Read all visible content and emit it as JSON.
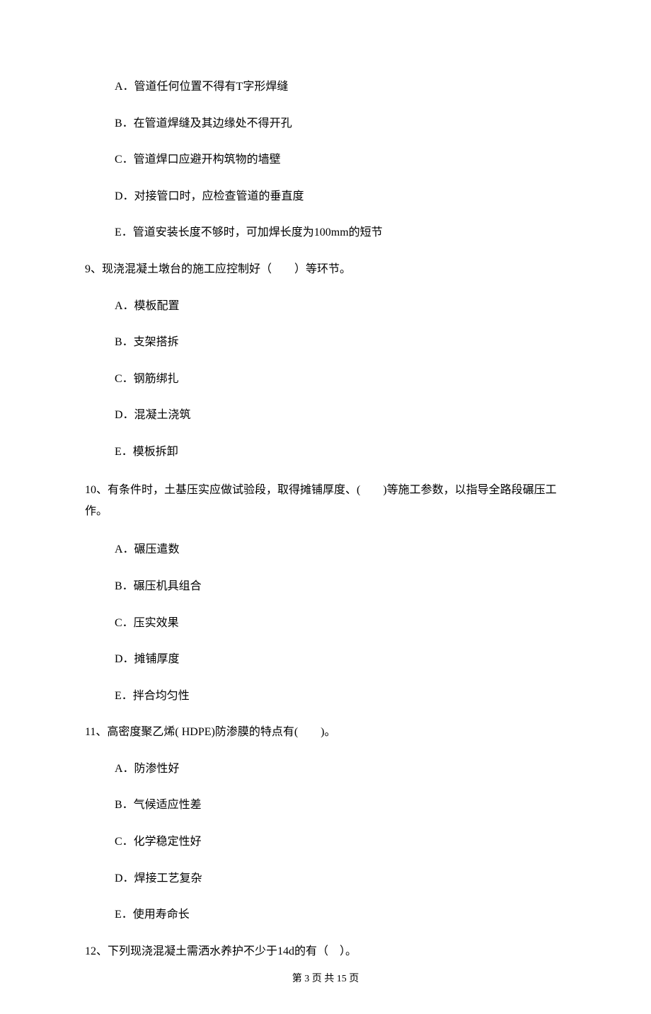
{
  "q8": {
    "options": {
      "A": "A．管道任何位置不得有T字形焊缝",
      "B": "B．在管道焊缝及其边缘处不得开孔",
      "C": "C．管道焊口应避开构筑物的墙壁",
      "D": "D．对接管口时，应检查管道的垂直度",
      "E": "E．管道安装长度不够时，可加焊长度为100mm的短节"
    }
  },
  "q9": {
    "stem": "9、现浇混凝土墩台的施工应控制好（　　）等环节。",
    "options": {
      "A": "A．模板配置",
      "B": "B．支架搭拆",
      "C": "C．钢筋绑扎",
      "D": "D．混凝土浇筑",
      "E": "E．模板拆卸"
    }
  },
  "q10": {
    "stem": "10、有条件时，土基压实应做试验段，取得摊铺厚度、(　　)等施工参数，以指导全路段碾压工作。",
    "options": {
      "A": "A．碾压遣数",
      "B": "B．碾压机具组合",
      "C": "C．压实效果",
      "D": "D．摊铺厚度",
      "E": "E．拌合均匀性"
    }
  },
  "q11": {
    "stem": "11、高密度聚乙烯( HDPE)防渗膜的特点有(　　)。",
    "options": {
      "A": "A．防渗性好",
      "B": "B．气候适应性差",
      "C": "C．化学稳定性好",
      "D": "D．焊接工艺复杂",
      "E": "E．使用寿命长"
    }
  },
  "q12": {
    "stem": "12、下列现浇混凝土需洒水养护不少于14d的有（　）。"
  },
  "footer": "第 3 页 共 15 页"
}
